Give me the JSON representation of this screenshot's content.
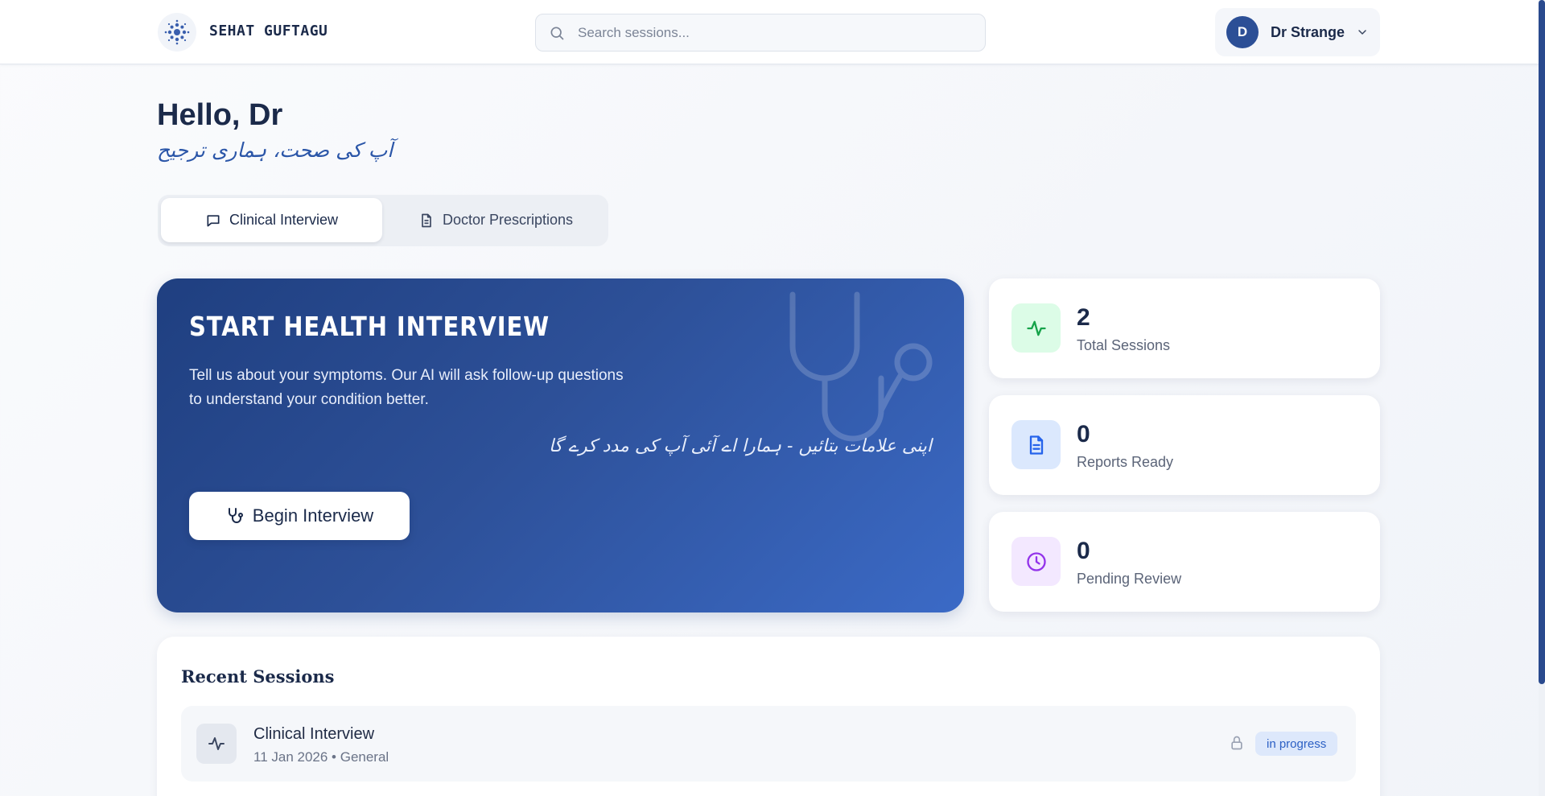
{
  "header": {
    "brand": "SEHAT GUFTAGU",
    "logo_icon": "lotus-logo-icon",
    "search": {
      "placeholder": "Search sessions...",
      "value": ""
    },
    "user": {
      "initial": "D",
      "name": "Dr Strange"
    }
  },
  "greeting": {
    "title": "Hello, Dr",
    "subtitle_urdu": "آپ کی صحت، ہماری ترجیح"
  },
  "tabs": [
    {
      "label": "Clinical Interview",
      "icon": "chat-icon",
      "active": true
    },
    {
      "label": "Doctor Prescriptions",
      "icon": "document-icon",
      "active": false
    }
  ],
  "hero": {
    "title": "START HEALTH INTERVIEW",
    "description": "Tell us about your symptoms. Our AI will ask follow-up questions to understand your condition better.",
    "urdu_text": "اپنی علامات بتائیں - ہمارا اے آئی آپ کی مدد کرے گا",
    "button_label": "Begin Interview",
    "colors": {
      "start": "#1f3f80",
      "end": "#3b6ac6"
    }
  },
  "stats": [
    {
      "value": "2",
      "label": "Total Sessions",
      "icon": "activity-icon",
      "color": "#16a34a",
      "bg": "#dcfce7"
    },
    {
      "value": "0",
      "label": "Reports Ready",
      "icon": "report-icon",
      "color": "#2563eb",
      "bg": "#dbe8fd"
    },
    {
      "value": "0",
      "label": "Pending Review",
      "icon": "clock-icon",
      "color": "#9333ea",
      "bg": "#f3e8ff"
    }
  ],
  "recent_sessions": {
    "title": "Recent Sessions",
    "items": [
      {
        "title": "Clinical Interview",
        "meta": "11 Jan 2026 • General",
        "status": "in progress",
        "icon": "activity-icon",
        "locked": true
      }
    ]
  }
}
